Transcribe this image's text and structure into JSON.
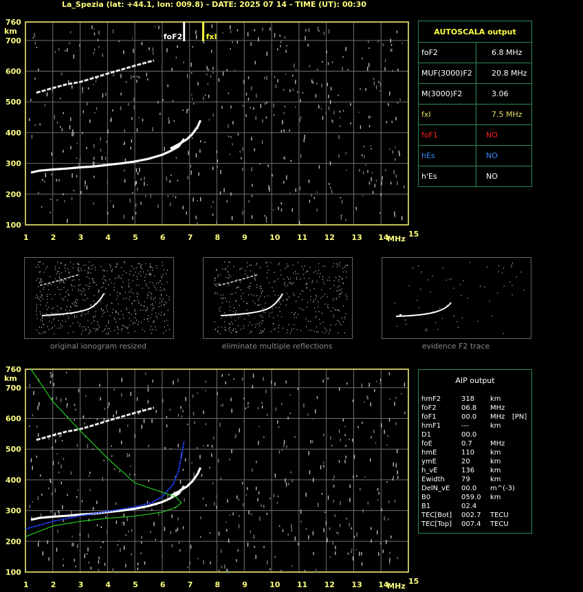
{
  "header": "La_Spezia (lat: +44.1, lon: 009.8) - DATE: 2025 07 14 - TIME (UT): 00:30",
  "axes": {
    "y_unit": "km",
    "x_unit": "MHz",
    "y_ticks": [
      "760",
      "700",
      "600",
      "500",
      "400",
      "300",
      "200",
      "100"
    ],
    "x_ticks": [
      "1",
      "2",
      "3",
      "4",
      "5",
      "6",
      "7",
      "8",
      "9",
      "10",
      "11",
      "12",
      "13",
      "14",
      "15"
    ]
  },
  "markers": {
    "foF2_label": "foF2",
    "fxl_label": "fxI"
  },
  "autoscala": {
    "title": "AUTOSCALA output",
    "rows": [
      {
        "name": "foF2",
        "value": "6.8 MHz",
        "color": "#ffffff"
      },
      {
        "name": "MUF(3000)F2",
        "value": "20.8 MHz",
        "color": "#ffffff"
      },
      {
        "name": "M(3000)F2",
        "value": "3.06",
        "color": "#ffffff"
      },
      {
        "name": "fxI",
        "value": "7.5 MHz",
        "color": "#e0e060"
      },
      {
        "name": "foF1",
        "value": "NO",
        "color": "#ff2020"
      },
      {
        "name": "hEs",
        "value": "NO",
        "color": "#3a8dff"
      },
      {
        "name": "h'Es",
        "value": "NO",
        "color": "#ffffff"
      }
    ]
  },
  "thumbnails": {
    "captions": [
      "original ionogram resized",
      "eliminate multiple reflections",
      "evidence F2 trace"
    ]
  },
  "aip": {
    "title": "AIP output",
    "rows": [
      {
        "name": "hmF2",
        "value": "318",
        "unit": "km",
        "extra": ""
      },
      {
        "name": "foF2",
        "value": "06.8",
        "unit": "MHz",
        "extra": ""
      },
      {
        "name": "foF1",
        "value": "00.0",
        "unit": "MHz",
        "extra": "[PN]"
      },
      {
        "name": "hmF1",
        "value": "---",
        "unit": "km",
        "extra": ""
      },
      {
        "name": "D1",
        "value": "00.0",
        "unit": "",
        "extra": ""
      },
      {
        "name": "foE",
        "value": "0.7",
        "unit": "MHz",
        "extra": ""
      },
      {
        "name": "hmE",
        "value": "110",
        "unit": "km",
        "extra": ""
      },
      {
        "name": "ymE",
        "value": "20",
        "unit": "km",
        "extra": ""
      },
      {
        "name": "h_vE",
        "value": "136",
        "unit": "km",
        "extra": ""
      },
      {
        "name": "Ewidth",
        "value": "79",
        "unit": "km",
        "extra": ""
      },
      {
        "name": "DelN_vE",
        "value": "00.0",
        "unit": "m^(-3)",
        "extra": ""
      },
      {
        "name": "B0",
        "value": "059.0",
        "unit": "km",
        "extra": ""
      },
      {
        "name": "B1",
        "value": "02.4",
        "unit": "",
        "extra": ""
      },
      {
        "name": "TEC[Bot]",
        "value": "002.7",
        "unit": "TECU",
        "extra": ""
      },
      {
        "name": "TEC[Top]",
        "value": "007.4",
        "unit": "TECU",
        "extra": ""
      }
    ]
  },
  "chart_data": [
    {
      "type": "scatter",
      "xlabel": "MHz",
      "ylabel": "km",
      "xlim": [
        1,
        15
      ],
      "ylim": [
        100,
        760
      ],
      "series": [
        {
          "values": [
            [
              1.2,
              270
            ],
            [
              1.5,
              276
            ],
            [
              2,
              280
            ],
            [
              2.5,
              283
            ],
            [
              3,
              287
            ],
            [
              3.5,
              290
            ],
            [
              4,
              295
            ],
            [
              4.5,
              300
            ],
            [
              5,
              306
            ],
            [
              5.5,
              315
            ],
            [
              6,
              328
            ],
            [
              6.3,
              340
            ],
            [
              6.6,
              355
            ],
            [
              6.8,
              380
            ]
          ]
        },
        {
          "values": [
            [
              6.3,
              348
            ],
            [
              6.6,
              362
            ],
            [
              6.9,
              378
            ],
            [
              7.1,
              395
            ],
            [
              7.3,
              420
            ],
            [
              7.4,
              440
            ]
          ]
        },
        {
          "values": [
            [
              1.4,
              530
            ],
            [
              2,
              545
            ],
            [
              2.5,
              557
            ],
            [
              3,
              565
            ],
            [
              3.5,
              578
            ],
            [
              4,
              592
            ],
            [
              4.5,
              605
            ],
            [
              5,
              618
            ],
            [
              5.5,
              630
            ],
            [
              5.7,
              635
            ]
          ]
        }
      ],
      "markers": [
        {
          "label": "foF2",
          "x": 6.8
        },
        {
          "label": "fxI",
          "x": 7.5
        }
      ]
    },
    {
      "type": "line",
      "xlabel": "MHz",
      "ylabel": "km",
      "xlim": [
        1,
        15
      ],
      "ylim": [
        100,
        760
      ],
      "series": [
        {
          "values": [
            [
              1.0,
              240
            ],
            [
              2,
              265
            ],
            [
              3,
              283
            ],
            [
              4,
              297
            ],
            [
              5,
              312
            ],
            [
              5.6,
              325
            ],
            [
              6,
              345
            ],
            [
              6.4,
              385
            ],
            [
              6.6,
              430
            ],
            [
              6.8,
              525
            ]
          ]
        },
        {
          "values": [
            [
              1.0,
              215
            ],
            [
              2,
              250
            ],
            [
              3,
              265
            ],
            [
              4,
              275
            ],
            [
              5,
              282
            ],
            [
              6,
              295
            ],
            [
              6.5,
              310
            ],
            [
              6.7,
              325
            ],
            [
              6.5,
              345
            ],
            [
              6,
              360
            ],
            [
              5,
              390
            ],
            [
              4,
              470
            ],
            [
              3,
              560
            ],
            [
              2,
              655
            ],
            [
              1.2,
              760
            ]
          ]
        }
      ]
    }
  ]
}
